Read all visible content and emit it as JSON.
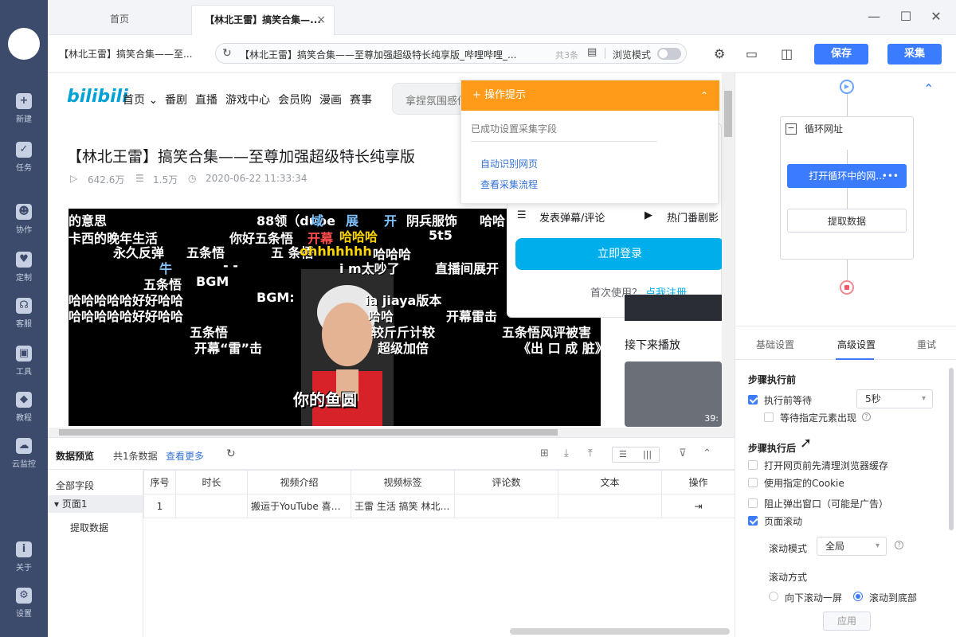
{
  "sidebar": {
    "items": [
      {
        "label": "新建",
        "icon": "plus-icon"
      },
      {
        "label": "任务",
        "icon": "task-icon"
      },
      {
        "label": "协作",
        "icon": "collab-icon"
      },
      {
        "label": "定制",
        "icon": "heart-icon"
      },
      {
        "label": "客服",
        "icon": "headset-icon"
      },
      {
        "label": "工具",
        "icon": "toolbox-icon"
      },
      {
        "label": "教程",
        "icon": "graduation-icon"
      },
      {
        "label": "云监控",
        "icon": "cloud-icon"
      },
      {
        "label": "关于",
        "icon": "info-icon"
      },
      {
        "label": "设置",
        "icon": "gear-icon"
      }
    ]
  },
  "tabs": [
    {
      "label": "首页"
    },
    {
      "label": "【林北王雷】搞笑合集—..."
    }
  ],
  "toolbar": {
    "page_title": "【林北王雷】搞笑合集——至...",
    "url": "【林北王雷】搞笑合集——至尊加强超级特长纯享版_哔哩哔哩_...",
    "count": "共3条",
    "browse_mode": "浏览模式",
    "save": "保存",
    "collect": "采集"
  },
  "bilibili": {
    "logo": "bilibili",
    "nav": [
      "首页 ⌄",
      "番剧",
      "直播",
      "游戏中心",
      "会员购",
      "漫画",
      "赛事"
    ],
    "search_placeholder": "拿捏氛围感他一直可以",
    "title": "【林北王雷】搞笑合集——至尊加强超级特长纯享版",
    "views": "642.6万",
    "danmaku": "1.5万",
    "date": "2020-06-22 11:33:34",
    "danmaku_lines": [
      "的意思",
      "88领（duoe",
      "域",
      "展",
      "开",
      "阴兵服饰",
      "哈哈",
      "卡西的晚年生活",
      "你好五条悟",
      "开幕",
      "哈哈哈",
      "5t5",
      "永久反弹",
      "五条悟",
      "五 条悟",
      "ohhhhhhh",
      "哈哈哈",
      "牛",
      "- -",
      "i m太吵了",
      "直播间展开",
      "五条悟",
      "BGM",
      "哈哈哈哈哈好好哈哈",
      "BGM:",
      "ia jiaya版本",
      "哈哈哈哈哈好好哈哈",
      "哈哈",
      "开幕雷击",
      "五条悟",
      "较斤斤计较",
      "五条悟风评被害",
      "开幕“雷”击",
      "超级加倍",
      "《出 口 成 脏》",
      "你的鱼圆"
    ],
    "comment_btn": "发表弹幕/评论",
    "hot_btn": "热门番剧影",
    "login_btn": "立即登录",
    "first_use": "首次使用？",
    "register": "点我注册",
    "next_play": "接下来播放",
    "thumb_time": "39:"
  },
  "tip_popup": {
    "title": "操作提示",
    "message": "已成功设置采集字段",
    "links": [
      "自动识别网页",
      "查看采集流程"
    ]
  },
  "data_preview": {
    "title": "数据预览",
    "count": "共1条数据",
    "more": "查看更多",
    "all_fields": "全部字段",
    "page1": "页面1",
    "extract": "提取数据",
    "columns": [
      "序号",
      "时长",
      "视频介绍",
      "视频标签",
      "评论数",
      "文本",
      "操作"
    ],
    "rows": [
      [
        "1",
        "",
        "搬运于YouTube 喜欢...",
        "王雷 生活 搞笑 林北 ...",
        "",
        "",
        "⇥"
      ]
    ]
  },
  "workflow": {
    "loop_label": "循环网址",
    "active_node": "打开循环中的网...",
    "extract_node": "提取数据"
  },
  "settings": {
    "tabs": [
      "基础设置",
      "高级设置",
      "重试"
    ],
    "before_title": "步骤执行前",
    "wait_before": "执行前等待",
    "wait_value": "5秒",
    "wait_element": "等待指定元素出现",
    "after_title": "步骤执行后",
    "clear_cache": "打开网页前先清理浏览器缓存",
    "use_cookie": "使用指定的Cookie",
    "block_popup": "阻止弹出窗口（可能是广告）",
    "page_scroll": "页面滚动",
    "scroll_mode_label": "滚动模式",
    "scroll_mode_value": "全局",
    "scroll_way_label": "滚动方式",
    "scroll_option1": "向下滚动一屏",
    "scroll_option2": "滚动到底部",
    "apply": "应用"
  }
}
